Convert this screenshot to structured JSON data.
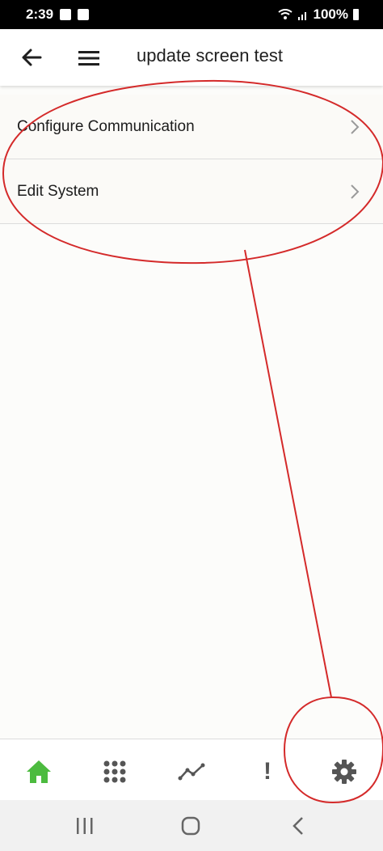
{
  "status_bar": {
    "time": "2:39",
    "battery": "100%"
  },
  "app_bar": {
    "title": "update screen test",
    "back_icon": "arrow-left-icon",
    "menu_icon": "hamburger-menu-icon"
  },
  "settings_list": {
    "items": [
      {
        "label": "Configure Communication"
      },
      {
        "label": "Edit System"
      }
    ]
  },
  "bottom_nav": {
    "items": [
      {
        "name": "home",
        "icon": "home-icon",
        "active": true
      },
      {
        "name": "apps",
        "icon": "grid-dots-icon"
      },
      {
        "name": "trends",
        "icon": "trend-line-icon"
      },
      {
        "name": "alerts",
        "icon": "exclamation-icon",
        "glyph": "!"
      },
      {
        "name": "settings",
        "icon": "gear-icon"
      }
    ],
    "active_color": "#4cbb3f",
    "icon_color": "#555555"
  },
  "system_nav": {
    "buttons": [
      "recents-icon",
      "home-circle-icon",
      "back-chevron-icon"
    ]
  },
  "annotation": {
    "color": "#d42a2a"
  }
}
